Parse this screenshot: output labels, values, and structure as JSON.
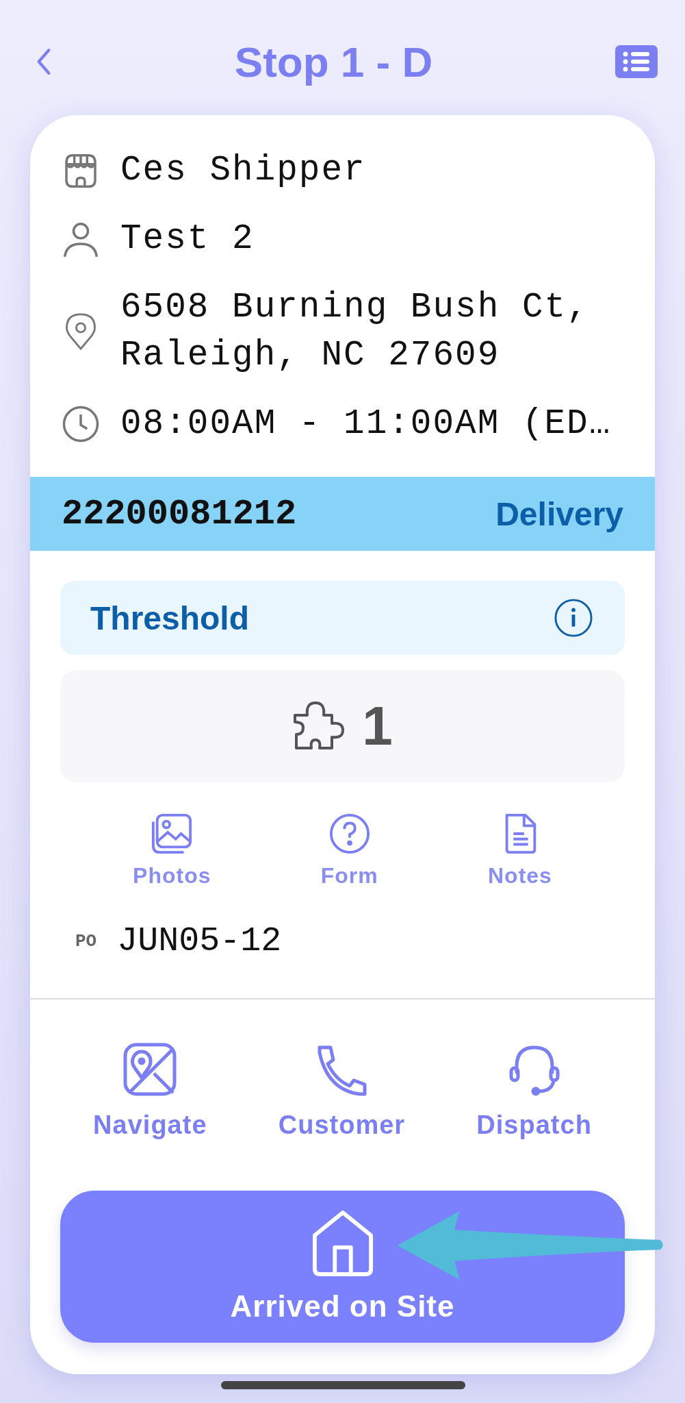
{
  "header": {
    "title": "Stop 1 - D"
  },
  "info": [
    {
      "kind": "shipper",
      "text": "Ces Shipper"
    },
    {
      "kind": "contact",
      "text": "Test 2"
    },
    {
      "kind": "address",
      "text": "6508 Burning Bush Ct, Raleigh, NC 27609"
    },
    {
      "kind": "time",
      "text": "08:00AM - 11:00AM (ED…"
    }
  ],
  "order": {
    "number": "22200081212",
    "type": "Delivery"
  },
  "service": {
    "label": "Threshold"
  },
  "pieces": {
    "count": "1"
  },
  "attachments": [
    {
      "kind": "photos",
      "label": "Photos"
    },
    {
      "kind": "form",
      "label": "Form"
    },
    {
      "kind": "notes",
      "label": "Notes"
    }
  ],
  "po": {
    "label": "PO",
    "value": "JUN05-12"
  },
  "contacts": [
    {
      "kind": "navigate",
      "label": "Navigate"
    },
    {
      "kind": "phone",
      "label": "Customer"
    },
    {
      "kind": "headset",
      "label": "Dispatch"
    }
  ],
  "primary_action": {
    "label": "Arrived on Site"
  }
}
